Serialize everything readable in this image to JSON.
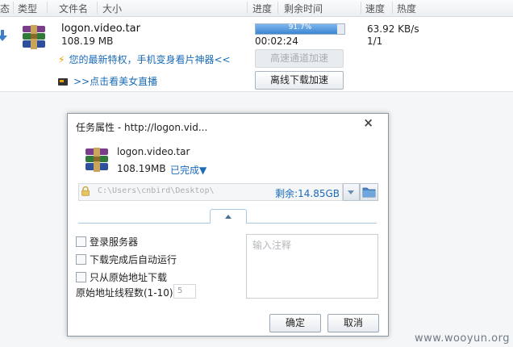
{
  "header": {
    "col_status": "态",
    "col_type": "类型",
    "col_filename": "文件名",
    "col_size": "大小",
    "col_progress": "进度",
    "col_remaining": "剩余时间",
    "col_speed": "速度",
    "col_heat": "热度"
  },
  "task": {
    "filename": "logon.video.tar",
    "size": "108.19 MB",
    "progress_text": "91.7%",
    "progress_value": 0.917,
    "remaining": "00:02:24",
    "speed": "63.92 KB/s",
    "connections": "1/1",
    "promo_privilege": "您的最新特权，手机变身看片神器<<",
    "promo_live": ">>点击看美女直播",
    "btn_fast_channel": "高速通道加速",
    "btn_offline": "离线下载加速"
  },
  "dialog": {
    "title": "任务属性 - http://logon.vid...",
    "close_glyph": "×",
    "filename": "logon.video.tar",
    "size": "108.19MB",
    "status": "已完成▼",
    "path": "C:\\Users\\cnbird\\Desktop\\",
    "free_space": "剩余:14.85GB",
    "opt_login_server": "登录服务器",
    "opt_autorun": "下载完成后自动运行",
    "opt_origin_only": "只从原始地址下载",
    "threads_label": "原始地址线程数(1-10)",
    "threads_value": "5",
    "notes_placeholder": "输入注释",
    "btn_ok": "确定",
    "btn_cancel": "取消"
  },
  "watermark": "www.wooyun.org",
  "colors": {
    "accent_blue": "#1a6bb8",
    "progress_fill": "#3b86d2",
    "promo_bolt": "#e8a100"
  }
}
